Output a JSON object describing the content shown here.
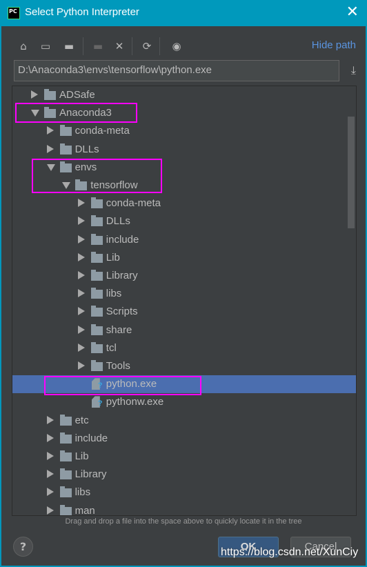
{
  "window": {
    "title": "Select Python Interpreter",
    "logo": "PC"
  },
  "toolbar": {
    "icons": [
      "home-icon",
      "desktop-icon",
      "project-folder-icon",
      "new-folder-icon",
      "delete-icon",
      "refresh-icon",
      "show-hidden-icon"
    ],
    "hide_path": "Hide path"
  },
  "path": {
    "value": "D:\\Anaconda3\\envs\\tensorflow\\python.exe"
  },
  "tree": [
    {
      "label": "ADSafe",
      "level": 0,
      "type": "folder",
      "state": "collapsed"
    },
    {
      "label": "Anaconda3",
      "level": 0,
      "type": "folder",
      "state": "expanded"
    },
    {
      "label": "conda-meta",
      "level": 1,
      "type": "folder",
      "state": "collapsed"
    },
    {
      "label": "DLLs",
      "level": 1,
      "type": "folder",
      "state": "collapsed"
    },
    {
      "label": "envs",
      "level": 1,
      "type": "folder",
      "state": "expanded"
    },
    {
      "label": "tensorflow",
      "level": 2,
      "type": "folder",
      "state": "expanded"
    },
    {
      "label": "conda-meta",
      "level": 3,
      "type": "folder",
      "state": "collapsed"
    },
    {
      "label": "DLLs",
      "level": 3,
      "type": "folder",
      "state": "collapsed"
    },
    {
      "label": "include",
      "level": 3,
      "type": "folder",
      "state": "collapsed"
    },
    {
      "label": "Lib",
      "level": 3,
      "type": "folder",
      "state": "collapsed"
    },
    {
      "label": "Library",
      "level": 3,
      "type": "folder",
      "state": "collapsed"
    },
    {
      "label": "libs",
      "level": 3,
      "type": "folder",
      "state": "collapsed"
    },
    {
      "label": "Scripts",
      "level": 3,
      "type": "folder",
      "state": "collapsed"
    },
    {
      "label": "share",
      "level": 3,
      "type": "folder",
      "state": "collapsed"
    },
    {
      "label": "tcl",
      "level": 3,
      "type": "folder",
      "state": "collapsed"
    },
    {
      "label": "Tools",
      "level": 3,
      "type": "folder",
      "state": "collapsed"
    },
    {
      "label": "python.exe",
      "level": 3,
      "type": "file",
      "selected": true
    },
    {
      "label": "pythonw.exe",
      "level": 3,
      "type": "file"
    },
    {
      "label": "etc",
      "level": 1,
      "type": "folder",
      "state": "collapsed"
    },
    {
      "label": "include",
      "level": 1,
      "type": "folder",
      "state": "collapsed"
    },
    {
      "label": "Lib",
      "level": 1,
      "type": "folder",
      "state": "collapsed"
    },
    {
      "label": "Library",
      "level": 1,
      "type": "folder",
      "state": "collapsed"
    },
    {
      "label": "libs",
      "level": 1,
      "type": "folder",
      "state": "collapsed"
    },
    {
      "label": "man",
      "level": 1,
      "type": "folder",
      "state": "collapsed"
    }
  ],
  "hint": "Drag and drop a file into the space above to quickly locate it in the tree",
  "buttons": {
    "help": "?",
    "ok": "OK",
    "cancel": "Cancel"
  },
  "watermark": "https://blog.csdn.net/XunCiy",
  "colors": {
    "titlebar": "#0099bc",
    "selection": "#4b6eaf",
    "highlight_box": "#ff00ff",
    "link": "#5a94e0"
  }
}
